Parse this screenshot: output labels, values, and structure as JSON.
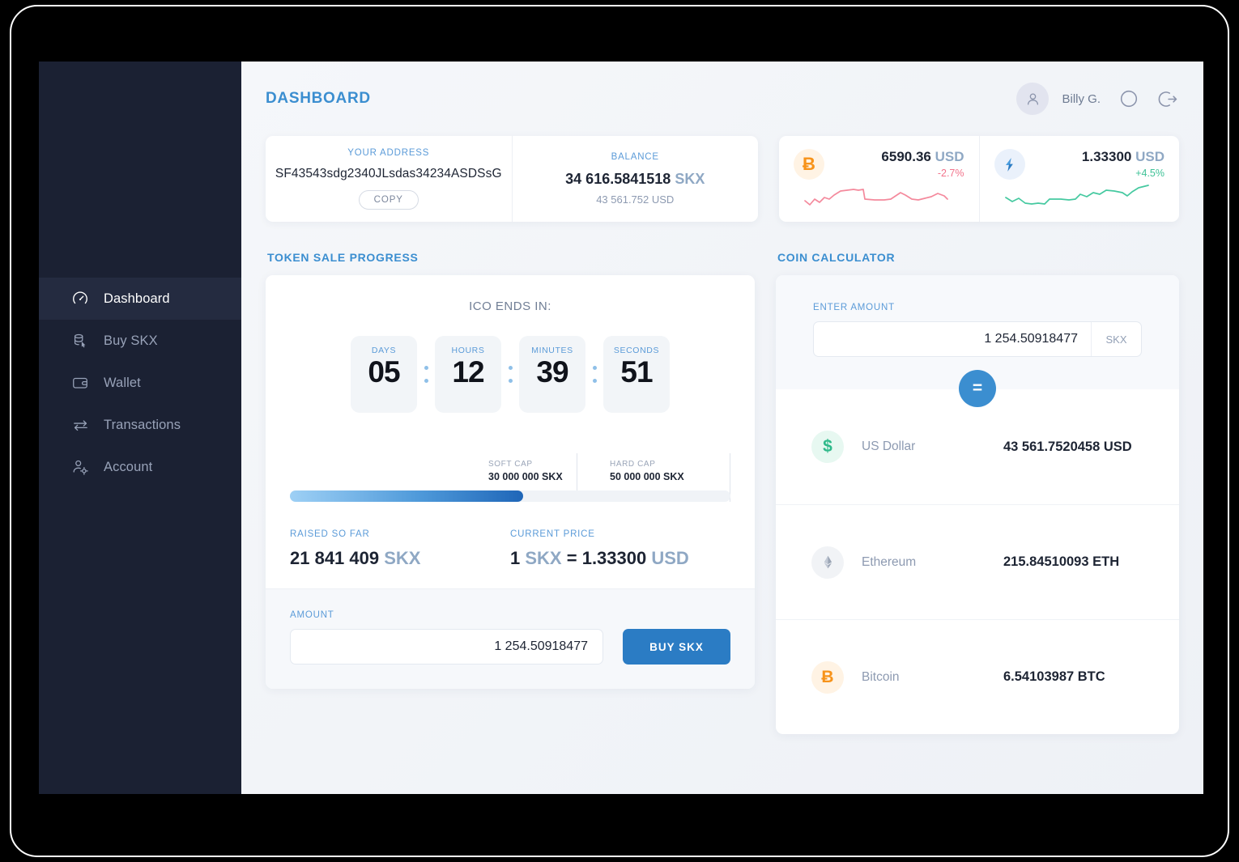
{
  "header": {
    "title": "DASHBOARD",
    "user_name": "Billy G.",
    "avatar_icon": "user-avatar-icon",
    "theme_icon": "dark-mode-toggle-icon",
    "logout_icon": "logout-icon"
  },
  "sidebar": {
    "items": [
      {
        "label": "Dashboard",
        "icon": "speedometer-icon",
        "active": true
      },
      {
        "label": "Buy SKX",
        "icon": "coins-cursor-icon",
        "active": false
      },
      {
        "label": "Wallet",
        "icon": "wallet-icon",
        "active": false
      },
      {
        "label": "Transactions",
        "icon": "exchange-arrows-icon",
        "active": false
      },
      {
        "label": "Account",
        "icon": "user-gear-icon",
        "active": false
      }
    ]
  },
  "address_card": {
    "address_label": "YOUR ADDRESS",
    "address_value": "SF43543sdg2340JLsdas34234ASDSsG",
    "copy_label": "COPY",
    "balance_label": "BALANCE",
    "balance_value": "34 616.5841518",
    "balance_unit": "SKX",
    "balance_sub": "43 561.752 USD"
  },
  "price_cards": [
    {
      "coin": "Bitcoin",
      "icon": "bitcoin-icon",
      "symbol": "Ƀ",
      "price": "6590.36",
      "unit": "USD",
      "change": "-2.7%",
      "direction": "down",
      "color": "#f2748c"
    },
    {
      "coin": "SKX",
      "icon": "skx-token-icon",
      "symbol": "",
      "price": "1.33300",
      "unit": "USD",
      "change": "+4.5%",
      "direction": "up",
      "color": "#3fc297"
    }
  ],
  "token_sale": {
    "section_title": "TOKEN SALE PROGRESS",
    "ico_label": "ICO ENDS IN:",
    "countdown": [
      {
        "label": "DAYS",
        "value": "05"
      },
      {
        "label": "HOURS",
        "value": "12"
      },
      {
        "label": "MINUTES",
        "value": "39"
      },
      {
        "label": "SECONDS",
        "value": "51"
      }
    ],
    "soft_cap_label": "SOFT CAP",
    "soft_cap_value": "30 000 000 SKX",
    "hard_cap_label": "HARD CAP",
    "hard_cap_value": "50 000 000 SKX",
    "progress_percent": 53,
    "raised_label": "RAISED SO FAR",
    "raised_value": "21 841 409",
    "raised_unit": "SKX",
    "price_label": "CURRENT PRICE",
    "price_one": "1",
    "price_skx": "SKX",
    "price_eq": "= 1.33300",
    "price_usd": "USD",
    "amount_label": "AMOUNT",
    "amount_value": "1 254.50918477",
    "amount_placeholder": "0.00",
    "buy_button": "BUY SKX"
  },
  "calculator": {
    "section_title": "COIN CALCULATOR",
    "enter_label": "ENTER AMOUNT",
    "amount_value": "1 254.50918477",
    "amount_placeholder": "0.00",
    "unit": "SKX",
    "equals_label": "=",
    "rows": [
      {
        "name": "US Dollar",
        "icon": "dollar-icon",
        "symbol": "$",
        "value": "43 561.7520458 USD"
      },
      {
        "name": "Ethereum",
        "icon": "ethereum-icon",
        "symbol": "",
        "value": "215.84510093 ETH"
      },
      {
        "name": "Bitcoin",
        "icon": "bitcoin-icon",
        "symbol": "Ƀ",
        "value": "6.54103987 BTC"
      }
    ]
  },
  "colors": {
    "accent": "#3b8ed0",
    "accent_dark": "#2b7cc4",
    "sidebar_bg": "#1b2133",
    "sidebar_active": "#242b40",
    "up": "#3fc297",
    "down": "#f2748c",
    "bitcoin": "#f7931a"
  }
}
